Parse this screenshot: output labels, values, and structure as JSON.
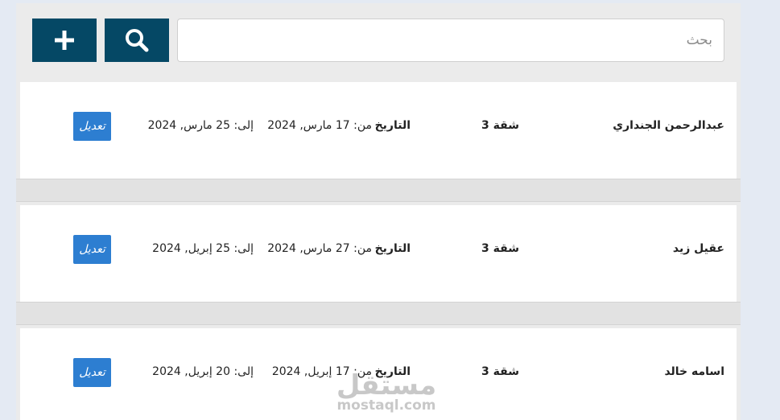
{
  "toolbar": {
    "add_icon": "plus-icon",
    "search_icon": "search-icon",
    "search_placeholder": "بحث",
    "search_value": ""
  },
  "records": [
    {
      "name": "عبدالرحمن الجنداري",
      "unit": "شقة 3",
      "date_label": "التاريخ",
      "from": "من: 17 مارس, 2024",
      "to": "إلى: 25 مارس, 2024",
      "edit_label": "تعديل"
    },
    {
      "name": "عقيل زيد",
      "unit": "شقة 3",
      "date_label": "التاريخ",
      "from": "من: 27 مارس, 2024",
      "to": "إلى: 25 إبريل, 2024",
      "edit_label": "تعديل"
    },
    {
      "name": "اسامه خالد",
      "unit": "شقة 3",
      "date_label": "التاريخ",
      "from": "من: 17 إبريل, 2024",
      "to": "إلى: 20 إبريل, 2024",
      "edit_label": "تعديل"
    }
  ],
  "watermark": {
    "arabic": "مستقل",
    "latin": "mostaql.com"
  },
  "colors": {
    "toolbar_button": "#054865",
    "edit_button": "#2d7ed1",
    "page_background": "#e4eaf3"
  }
}
